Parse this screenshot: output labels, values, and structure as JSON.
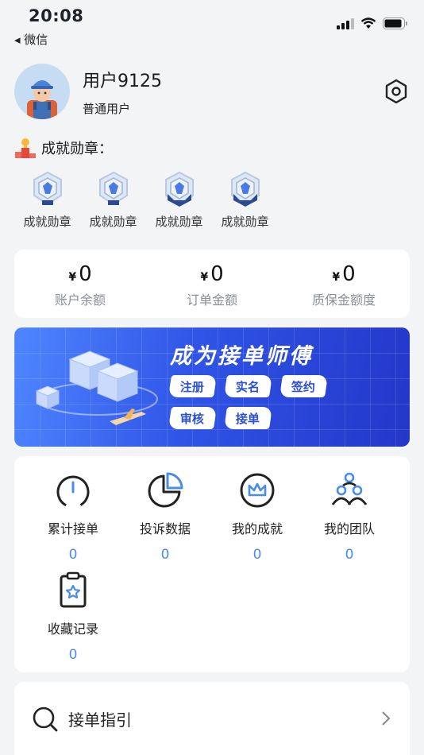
{
  "status_bar": {
    "time": "20:08",
    "back_label": "◂ 微信"
  },
  "profile": {
    "username": "用户9125",
    "user_type": "普通用户"
  },
  "achievements": {
    "title": "成就勋章：",
    "medals": [
      {
        "label": "成就勋章"
      },
      {
        "label": "成就勋章"
      },
      {
        "label": "成就勋章"
      },
      {
        "label": "成就勋章"
      }
    ]
  },
  "balances": [
    {
      "currency": "¥",
      "value": "0",
      "label": "账户余额"
    },
    {
      "currency": "¥",
      "value": "0",
      "label": "订单金额"
    },
    {
      "currency": "¥",
      "value": "0",
      "label": "质保金额度"
    }
  ],
  "banner": {
    "title": "成为接单师傅",
    "steps": [
      "注册",
      "实名",
      "签约",
      "审核",
      "接单"
    ]
  },
  "menu": [
    {
      "label": "累计接单",
      "count": "0",
      "icon": "gauge-icon"
    },
    {
      "label": "投诉数据",
      "count": "0",
      "icon": "pie-chart-icon"
    },
    {
      "label": "我的成就",
      "count": "0",
      "icon": "crown-icon"
    },
    {
      "label": "我的团队",
      "count": "0",
      "icon": "team-icon"
    },
    {
      "label": "收藏记录",
      "count": "0",
      "icon": "clipboard-star-icon"
    }
  ],
  "guide": {
    "label": "接单指引",
    "icon": "search-icon"
  },
  "colors": {
    "accent": "#4a8de8",
    "banner": "#2f54e6",
    "background": "#f3f4f6"
  }
}
